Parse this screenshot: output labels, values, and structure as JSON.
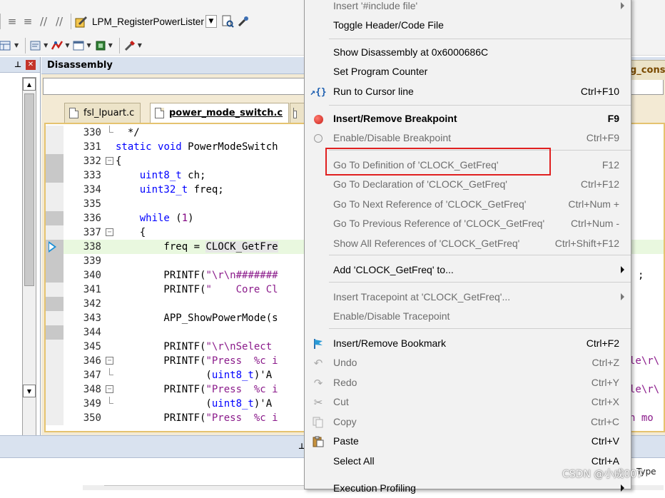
{
  "toolbar": {
    "function_combo": "LPM_RegisterPowerLister"
  },
  "disassembly": {
    "title": "Disassembly"
  },
  "tabs": [
    {
      "label": "fsl_lpuart.c",
      "active": false
    },
    {
      "label": "power_mode_switch.c",
      "active": true
    },
    {
      "label": "g_cons",
      "active": false
    }
  ],
  "code_lines": [
    {
      "num": "330",
      "text": "  */"
    },
    {
      "num": "331",
      "text": "static void PowerModeSwitch"
    },
    {
      "num": "332",
      "text": "{"
    },
    {
      "num": "333",
      "text": "    uint8_t ch;"
    },
    {
      "num": "334",
      "text": "    uint32_t freq;"
    },
    {
      "num": "335",
      "text": ""
    },
    {
      "num": "336",
      "text": "    while (1)"
    },
    {
      "num": "337",
      "text": "    {"
    },
    {
      "num": "338",
      "text": "        freq = CLOCK_GetFre"
    },
    {
      "num": "339",
      "text": ""
    },
    {
      "num": "340",
      "text": "        PRINTF(\"\\r\\n#######"
    },
    {
      "num": "341",
      "text": "        PRINTF(\"    Core Cl"
    },
    {
      "num": "342",
      "text": ""
    },
    {
      "num": "343",
      "text": "        APP_ShowPowerMode(s"
    },
    {
      "num": "344",
      "text": ""
    },
    {
      "num": "345",
      "text": "        PRINTF(\"\\r\\nSelect"
    },
    {
      "num": "346",
      "text": "        PRINTF(\"Press  %c i"
    },
    {
      "num": "347",
      "text": "               (uint8_t)'A"
    },
    {
      "num": "348",
      "text": "        PRINTF(\"Press  %c i"
    },
    {
      "num": "349",
      "text": "               (uint8_t)'A"
    },
    {
      "num": "350",
      "text": "        PRINTF(\"Press  %c i"
    }
  ],
  "code_right_fragments": {
    "line340": ";",
    "line346": "le\\r\\",
    "line348": "le\\r\\",
    "line350": "n mo"
  },
  "context_menu": {
    "items": [
      {
        "label": "Insert '#include file'",
        "shortcut": "",
        "submenu": true,
        "enabled": false
      },
      {
        "label": "Toggle Header/Code File",
        "shortcut": "",
        "enabled": true
      },
      {
        "label": "Show Disassembly at 0x6000686C",
        "shortcut": "",
        "enabled": true
      },
      {
        "label": "Set Program Counter",
        "shortcut": "",
        "enabled": true
      },
      {
        "label": "Run to Cursor line",
        "shortcut": "Ctrl+F10",
        "enabled": true,
        "icon": "run-to-cursor-icon"
      },
      {
        "label": "Insert/Remove Breakpoint",
        "shortcut": "F9",
        "enabled": true,
        "bold": true,
        "icon": "breakpoint-icon"
      },
      {
        "label": "Enable/Disable Breakpoint",
        "shortcut": "Ctrl+F9",
        "enabled": false,
        "icon": "breakpoint-disabled-icon"
      },
      {
        "label": "Go To Definition of 'CLOCK_GetFreq'",
        "shortcut": "F12",
        "enabled": false
      },
      {
        "label": "Go To Declaration of 'CLOCK_GetFreq'",
        "shortcut": "Ctrl+F12",
        "enabled": false
      },
      {
        "label": "Go To Next Reference of 'CLOCK_GetFreq'",
        "shortcut": "Ctrl+Num +",
        "enabled": false
      },
      {
        "label": "Go To Previous Reference of 'CLOCK_GetFreq'",
        "shortcut": "Ctrl+Num -",
        "enabled": false
      },
      {
        "label": "Show All References of 'CLOCK_GetFreq'",
        "shortcut": "Ctrl+Shift+F12",
        "enabled": false
      },
      {
        "label": "Add 'CLOCK_GetFreq' to...",
        "shortcut": "",
        "submenu": true,
        "enabled": true
      },
      {
        "label": "Insert Tracepoint at 'CLOCK_GetFreq'...",
        "shortcut": "",
        "submenu": true,
        "enabled": false
      },
      {
        "label": "Enable/Disable Tracepoint",
        "shortcut": "",
        "enabled": false
      },
      {
        "label": "Insert/Remove Bookmark",
        "shortcut": "Ctrl+F2",
        "enabled": true,
        "icon": "bookmark-icon"
      },
      {
        "label": "Undo",
        "shortcut": "Ctrl+Z",
        "enabled": false,
        "icon": "undo-icon"
      },
      {
        "label": "Redo",
        "shortcut": "Ctrl+Y",
        "enabled": false,
        "icon": "redo-icon"
      },
      {
        "label": "Cut",
        "shortcut": "Ctrl+X",
        "enabled": false,
        "icon": "cut-icon"
      },
      {
        "label": "Copy",
        "shortcut": "Ctrl+C",
        "enabled": false,
        "icon": "copy-icon"
      },
      {
        "label": "Paste",
        "shortcut": "Ctrl+V",
        "enabled": true,
        "icon": "paste-icon"
      },
      {
        "label": "Select All",
        "shortcut": "Ctrl+A",
        "enabled": true
      },
      {
        "label": "Execution Profiling",
        "shortcut": "",
        "submenu": true,
        "enabled": true
      }
    ]
  },
  "bottom_panel": {
    "type_label": "Type"
  },
  "watermark": "CSDN @小成007",
  "colors": {
    "highlight_box": "#e02020",
    "current_line": "#e9f8df",
    "editor_border": "#e5c36f",
    "keyword": "#0000ff",
    "string": "#8b1b8b"
  }
}
